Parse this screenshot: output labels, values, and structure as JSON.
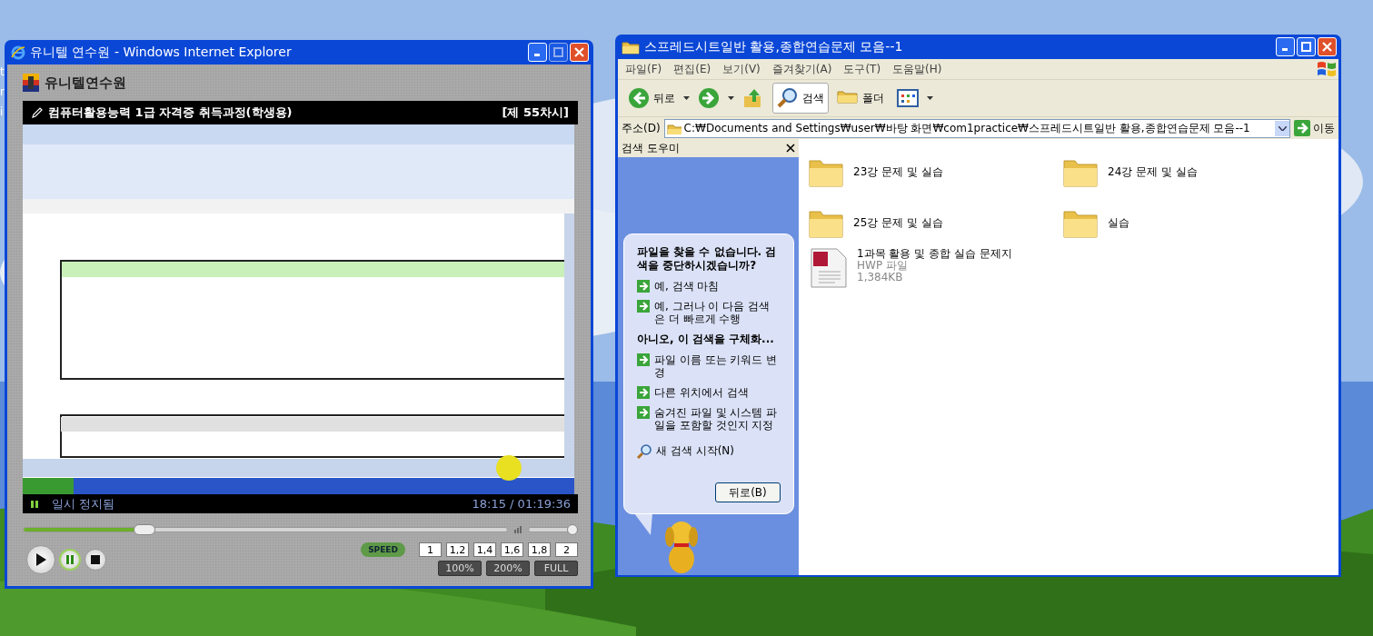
{
  "desktop": {
    "icon_labels": [
      "t",
      "r",
      "i"
    ]
  },
  "player_window": {
    "title": "유니텔 연수원 - Windows Internet Explorer",
    "brand": "유니텔연수원",
    "course_title": "컴퓨터활용능력 1급 자격증 취득과정(학생용)",
    "lesson": "[제 55차시]",
    "status": {
      "paused": true,
      "text": "일시 정지됨",
      "time": "18:15 / 01:19:36"
    },
    "seek": {
      "level": 0.24
    },
    "volume": {
      "level": 1.0
    },
    "controls": [
      {
        "kind": "play",
        "selected": false
      },
      {
        "kind": "pause",
        "selected": true
      },
      {
        "kind": "stop",
        "selected": false
      }
    ],
    "speed_label": "SPEED",
    "speeds": [
      "1",
      "1,2",
      "1,4",
      "1,6",
      "1,8",
      "2"
    ],
    "zoom_buttons": [
      "100%",
      "200%",
      "FULL"
    ]
  },
  "explorer_window": {
    "title": "스프레드시트일반 활용,종합연습문제 모음--1",
    "menu": [
      "파일(F)",
      "편집(E)",
      "보기(V)",
      "즐겨찾기(A)",
      "도구(T)",
      "도움말(H)"
    ],
    "toolbar": [
      {
        "kind": "back",
        "label": "뒤로",
        "pressed": false
      },
      {
        "kind": "forward",
        "pressed": false
      },
      {
        "kind": "up",
        "pressed": false
      },
      {
        "kind": "search",
        "label": "검색",
        "pressed": true
      },
      {
        "kind": "folders",
        "label": "폴더",
        "pressed": false
      },
      {
        "kind": "views",
        "pressed": false
      }
    ],
    "address": {
      "label": "주소(D)",
      "value": "C:₩Documents and Settings₩user₩바탕 화면₩com1practice₩스프레드시트일반 활용,종합연습문제 모음--1",
      "go": "이동"
    },
    "search_pane": {
      "title": "검색 도우미",
      "prompt": "파일을 찾을 수 없습니다. 검색을 중단하시겠습니까?",
      "options": [
        "예, 검색 마침",
        "예, 그러나 이 다음 검색은 더 빠르게 수행"
      ],
      "refine_heading": "아니오, 이 검색을 구체화...",
      "refine_options": [
        "파일 이름 또는 키워드 변경",
        "다른 위치에서 검색",
        "숨겨진 파일 및 시스템 파일을 포함할 것인지 지정"
      ],
      "new_search": "새 검색 시작(N)",
      "back_button": "뒤로(B)"
    },
    "files": [
      {
        "kind": "folder",
        "name": "23강 문제 및 실습"
      },
      {
        "kind": "folder",
        "name": "24강 문제 및 실습"
      },
      {
        "kind": "folder",
        "name": "25강 문제 및 실습"
      },
      {
        "kind": "folder",
        "name": "실습"
      },
      {
        "kind": "hwp",
        "name": "1과목 활용 및 종합 실습 문제지",
        "type": "HWP 파일",
        "size": "1,384KB"
      }
    ]
  }
}
